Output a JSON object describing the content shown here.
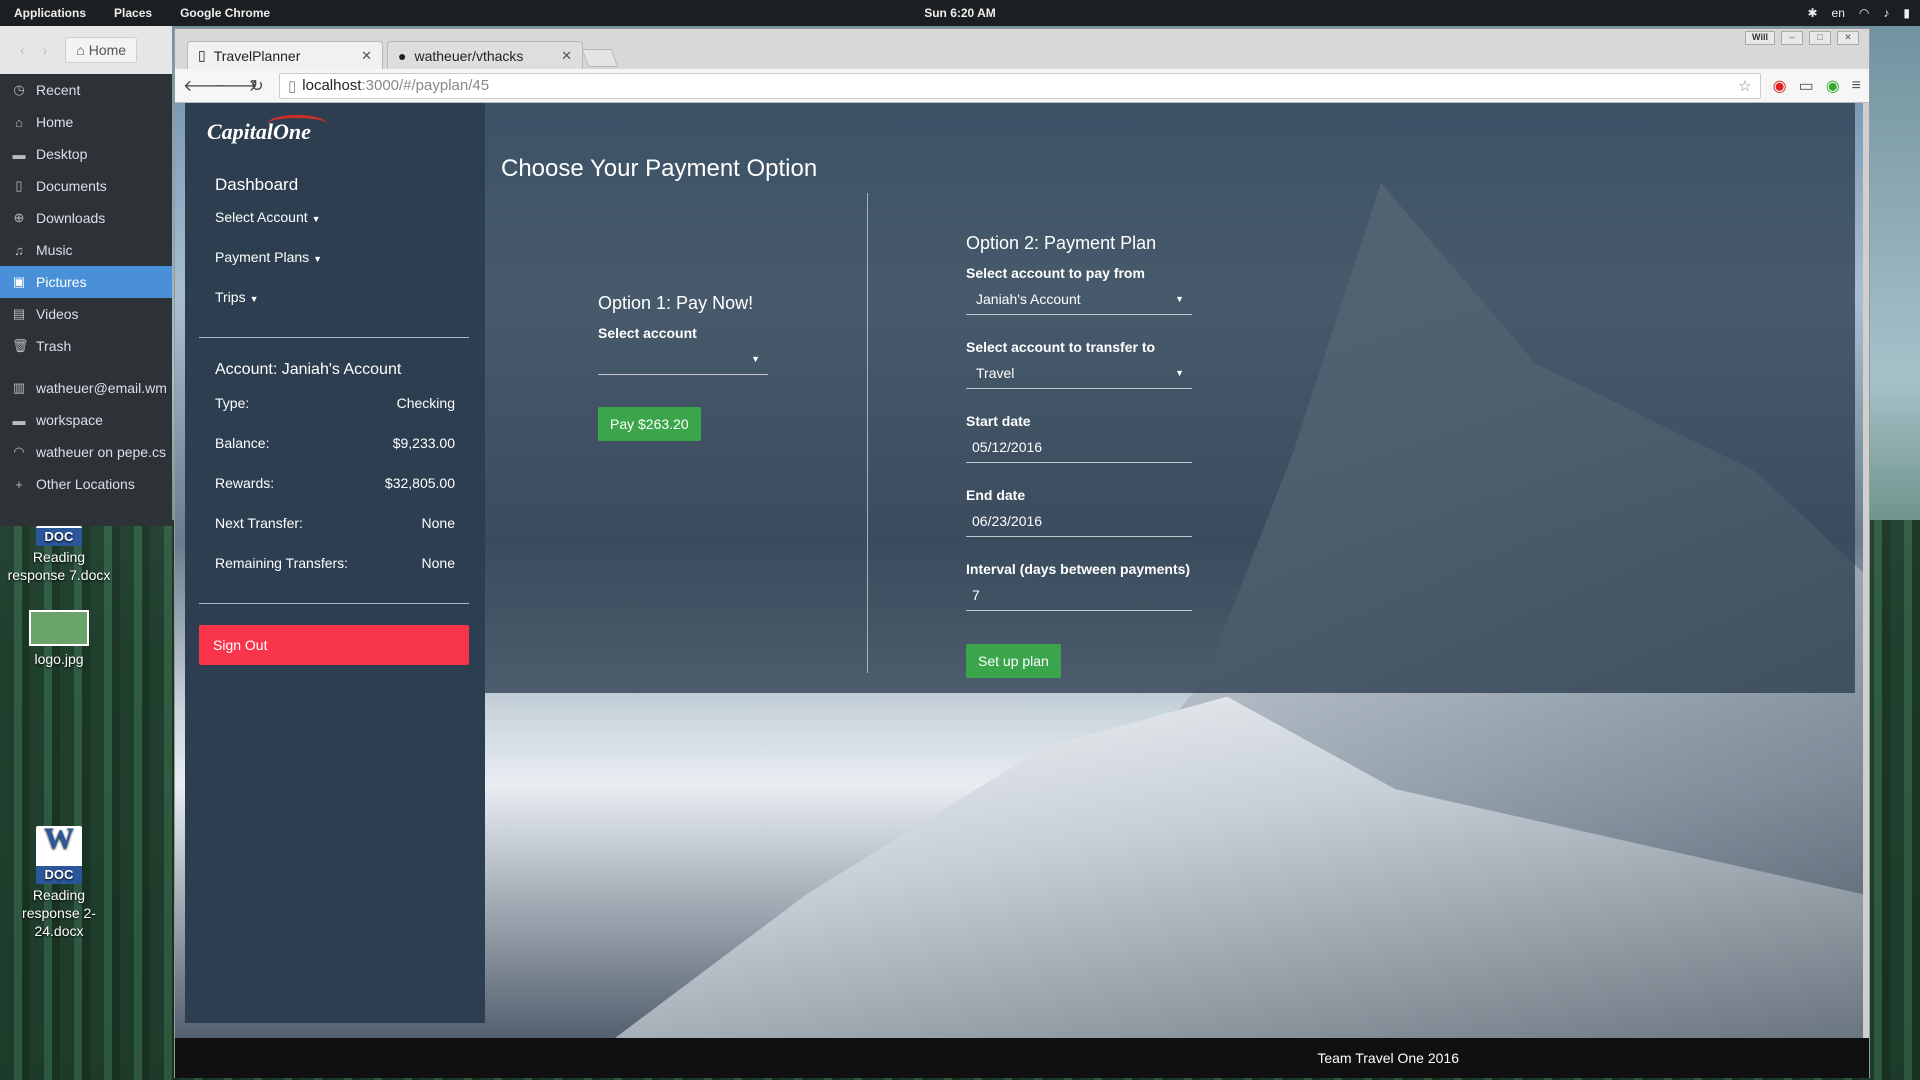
{
  "topbar": {
    "menus": [
      "Applications",
      "Places",
      "Google Chrome"
    ],
    "clock": "Sun  6:20 AM",
    "lang": "en"
  },
  "files": {
    "home_label": "Home",
    "items": [
      {
        "label": "Recent",
        "icon": "clock-icon"
      },
      {
        "label": "Home",
        "icon": "home-icon"
      },
      {
        "label": "Desktop",
        "icon": "folder-icon"
      },
      {
        "label": "Documents",
        "icon": "document-icon"
      },
      {
        "label": "Downloads",
        "icon": "download-icon"
      },
      {
        "label": "Music",
        "icon": "music-icon"
      },
      {
        "label": "Pictures",
        "icon": "pictures-icon",
        "active": true
      },
      {
        "label": "Videos",
        "icon": "video-icon"
      },
      {
        "label": "Trash",
        "icon": "trash-icon"
      }
    ],
    "extra": [
      {
        "label": "watheuer@email.wm",
        "icon": "drive-icon"
      },
      {
        "label": "workspace",
        "icon": "folder-icon"
      },
      {
        "label": "watheuer on pepe.cs",
        "icon": "network-icon"
      },
      {
        "label": "Other Locations",
        "icon": "plus-icon"
      }
    ]
  },
  "desktop": {
    "icons": [
      {
        "label": "Reading response 7.docx",
        "badge": "DOC"
      },
      {
        "label": "logo.jpg"
      },
      {
        "label": "Reading response 2-24.docx",
        "badge": "DOC"
      }
    ]
  },
  "browser": {
    "tabs": [
      {
        "title": "TravelPlanner"
      },
      {
        "title": "watheuer/vthacks"
      }
    ],
    "url_host": "localhost",
    "url_path": ":3000/#/payplan/45",
    "profile": "Will"
  },
  "sidebar": {
    "logo": "CapitalOne",
    "dashboard": "Dashboard",
    "menus": [
      "Select Account",
      "Payment Plans",
      "Trips"
    ],
    "account_title": "Account: Janiah's Account",
    "fields": [
      {
        "label": "Type:",
        "value": "Checking"
      },
      {
        "label": "Balance:",
        "value": "$9,233.00"
      },
      {
        "label": "Rewards:",
        "value": "$32,805.00"
      },
      {
        "label": "Next Transfer:",
        "value": "None"
      },
      {
        "label": "Remaining Transfers:",
        "value": "None"
      }
    ],
    "sign_out": "Sign Out"
  },
  "page": {
    "title": "Choose Your Payment Option",
    "option1": {
      "title": "Option 1: Pay Now!",
      "select_label": "Select account",
      "select_value": "",
      "pay_button": "Pay $263.20"
    },
    "option2": {
      "title": "Option 2: Payment Plan",
      "from_label": "Select account to pay from",
      "from_value": "Janiah's Account",
      "to_label": "Select account to transfer to",
      "to_value": "Travel",
      "start_label": "Start date",
      "start_value": "05/12/2016",
      "end_label": "End date",
      "end_value": "06/23/2016",
      "interval_label": "Interval (days between payments)",
      "interval_value": "7",
      "submit": "Set up plan"
    },
    "footer": "Team Travel One 2016"
  },
  "colors": {
    "accent_green": "#3aa54a",
    "signout_red": "#f9354c",
    "sidebar_bg": "#2c3e50"
  }
}
